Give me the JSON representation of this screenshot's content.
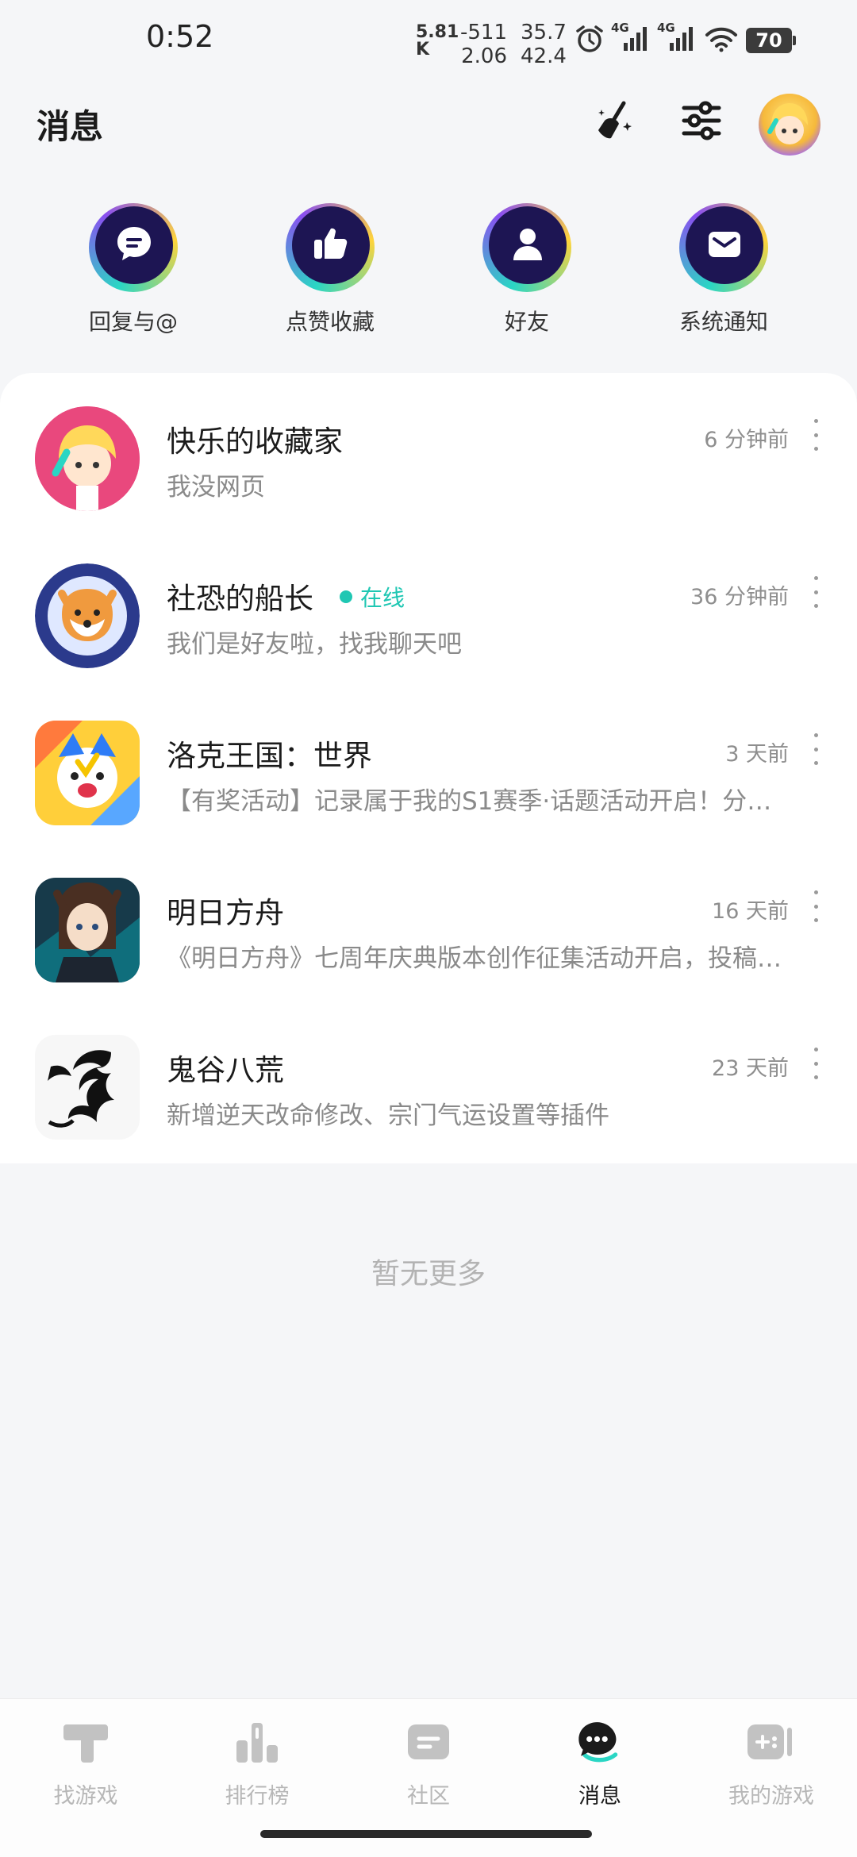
{
  "status_bar": {
    "time": "0:52",
    "net_speed_value": "5.81",
    "net_speed_unit": "K",
    "stat1_top": "-511",
    "stat1_bottom": "2.06",
    "stat2_top": "35.7",
    "stat2_bottom": "42.4",
    "signal1_label": "4G",
    "signal2_label": "4G",
    "battery": "70",
    "icons": [
      "alarm-icon",
      "signal-icon",
      "signal-icon",
      "wifi-icon",
      "battery-icon"
    ]
  },
  "header": {
    "title": "消息",
    "actions": [
      "broom-icon",
      "sliders-icon",
      "profile-avatar"
    ]
  },
  "quick_actions": [
    {
      "label": "回复与@",
      "icon": "chat-bubble-icon"
    },
    {
      "label": "点赞收藏",
      "icon": "thumbs-up-icon"
    },
    {
      "label": "好友",
      "icon": "person-icon"
    },
    {
      "label": "系统通知",
      "icon": "envelope-icon"
    }
  ],
  "messages": [
    {
      "name": "快乐的收藏家",
      "time": "6 分钟前",
      "preview": "我没网页",
      "online": ""
    },
    {
      "name": "社恐的船长",
      "time": "36 分钟前",
      "preview": "我们是好友啦，找我聊天吧",
      "online": "在线"
    },
    {
      "name": "洛克王国：世界",
      "time": "3 天前",
      "preview": "【有奖活动】记录属于我的S1赛季·话题活动开启！分…",
      "online": ""
    },
    {
      "name": "明日方舟",
      "time": "16 天前",
      "preview": "《明日方舟》七周年庆典版本创作征集活动开启，投稿…",
      "online": ""
    },
    {
      "name": "鬼谷八荒",
      "time": "23 天前",
      "preview": "新增逆天改命修改、宗门气运设置等插件",
      "online": ""
    }
  ],
  "footer_text": "暂无更多",
  "bottom_nav": [
    {
      "label": "找游戏",
      "icon": "find-game-icon"
    },
    {
      "label": "排行榜",
      "icon": "ranking-icon"
    },
    {
      "label": "社区",
      "icon": "community-icon"
    },
    {
      "label": "消息",
      "icon": "message-icon",
      "active": true
    },
    {
      "label": "我的游戏",
      "icon": "my-games-icon"
    }
  ],
  "colors": {
    "accent": "#1fc7b3",
    "icon_dark": "#1d1553",
    "inactive": "#b7b7b7"
  }
}
